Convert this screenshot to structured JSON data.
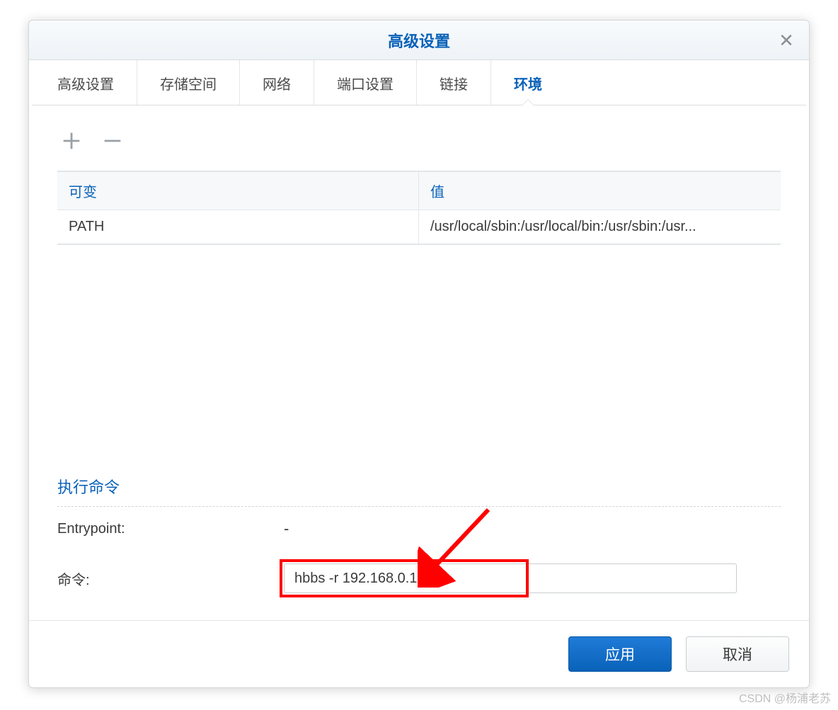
{
  "dialog": {
    "title": "高级设置",
    "close_glyph": "✕"
  },
  "tabs": [
    {
      "label": "高级设置",
      "active": false
    },
    {
      "label": "存储空间",
      "active": false
    },
    {
      "label": "网络",
      "active": false
    },
    {
      "label": "端口设置",
      "active": false
    },
    {
      "label": "链接",
      "active": false
    },
    {
      "label": "环境",
      "active": true
    }
  ],
  "env_table": {
    "headers": {
      "variable": "可变",
      "value": "值"
    },
    "rows": [
      {
        "variable": "PATH",
        "value": "/usr/local/sbin:/usr/local/bin:/usr/sbin:/usr..."
      }
    ]
  },
  "exec": {
    "section_title": "执行命令",
    "entrypoint_label": "Entrypoint:",
    "entrypoint_value": "-",
    "command_label": "命令:",
    "command_value": "hbbs -r 192.168.0.197"
  },
  "footer": {
    "apply": "应用",
    "cancel": "取消"
  },
  "watermark": "CSDN @杨浦老苏"
}
